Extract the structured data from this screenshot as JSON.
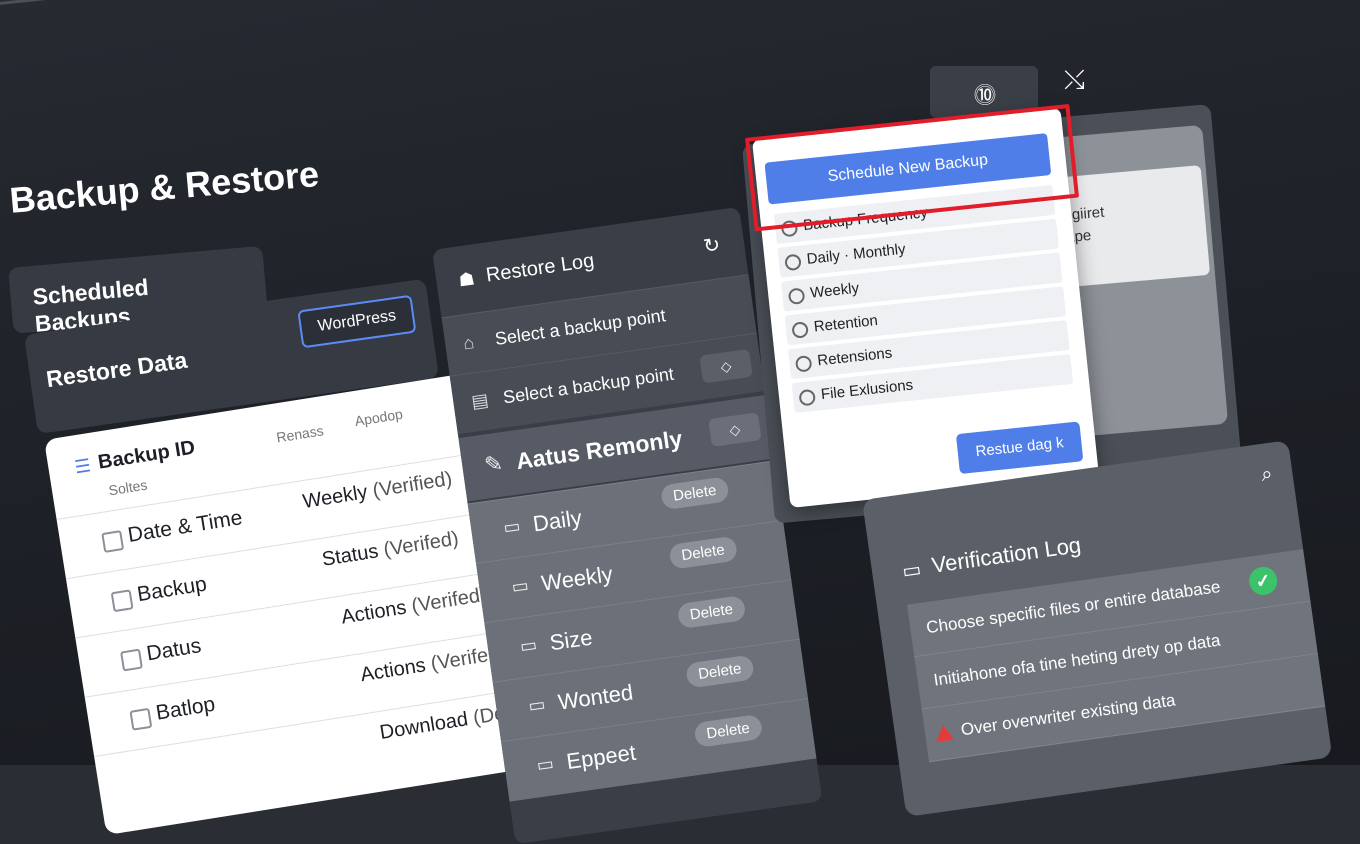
{
  "page": {
    "title": "Backup & Restore"
  },
  "left": {
    "scheduled_label": "Scheduled Backups",
    "restore_data_label": "Restore Data",
    "wordpress_button": "WordPress",
    "table": {
      "header": {
        "backup_id": "Backup ID",
        "sub": "Soltes",
        "col2": "Renass",
        "col3": "Apodop"
      },
      "rows": [
        {
          "name": "Date & Time",
          "value": "Weekly",
          "note": "(Verified)"
        },
        {
          "name": "Backup",
          "value": "Status",
          "note": "(Verifed)"
        },
        {
          "name": "Datus",
          "value": "Actions",
          "note": "(Verifed)"
        },
        {
          "name": "Batlop",
          "value": "Actions",
          "note": "(Verifed)"
        },
        {
          "name": "",
          "value": "Download",
          "note": "(Delet)"
        }
      ]
    }
  },
  "restore_log": {
    "title": "Restore Log",
    "select1": "Select a backup point",
    "select2": "Select a backup point",
    "aatus": "Aatus Remonly",
    "frequencies": [
      {
        "label": "Daily",
        "action": "Delete"
      },
      {
        "label": "Weekly",
        "action": "Delete"
      },
      {
        "label": "Size",
        "action": "Delete"
      },
      {
        "label": "Wonted",
        "action": "Delete"
      },
      {
        "label": "Eppeet",
        "action": "Delete"
      }
    ]
  },
  "dropdown": {
    "schedule_button": "Schedule New Backup",
    "options": [
      "Backup Frequency",
      "Daily · Monthly",
      "Weekly",
      "Retention",
      "Retensions",
      "File Exlusions"
    ],
    "apply_button": "Restue dag k"
  },
  "side_card": {
    "line1": "mgiiret",
    "line2": "rape"
  },
  "verification": {
    "title": "Verification Log",
    "rows": [
      "Choose specific files or entire database",
      "Initiahone ofa tine heting drety op data",
      "Over overwriter existing data"
    ]
  },
  "icons": {
    "refresh": "refresh-icon",
    "search": "search-icon",
    "close": "close-icon",
    "user": "user-tab-icon"
  },
  "colors": {
    "accent": "#4f7ee8",
    "highlight": "#e11d2a",
    "success": "#3cc36a",
    "warning": "#e23b3b"
  }
}
